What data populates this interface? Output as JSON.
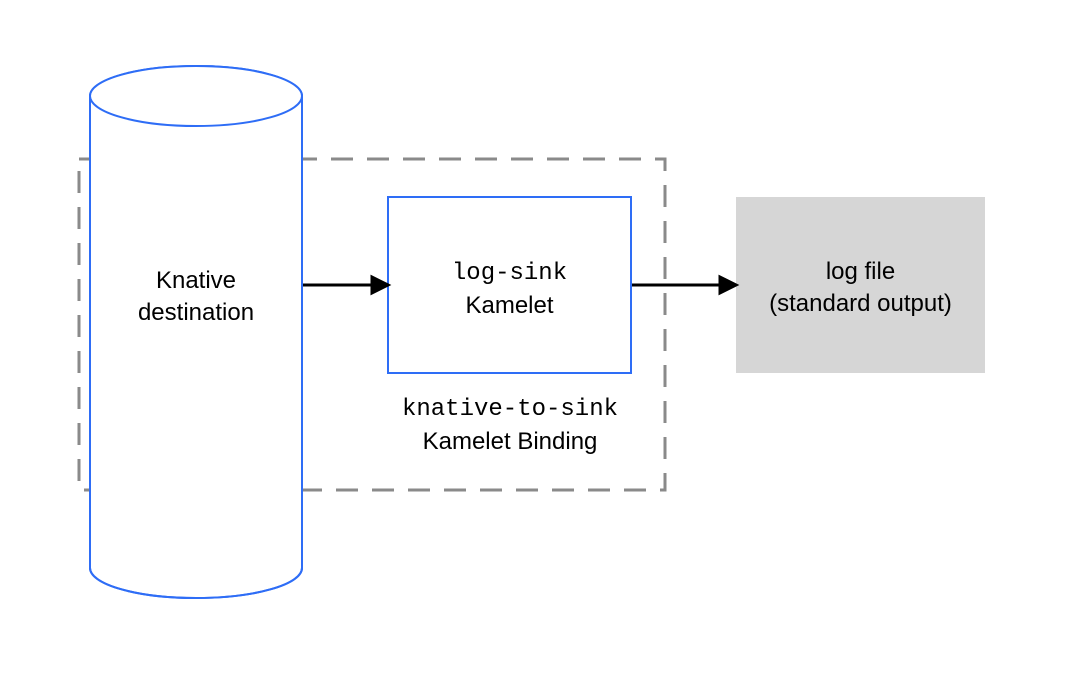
{
  "colors": {
    "blue": "#2e6df6",
    "gray_border": "#8a8a8a",
    "gray_fill": "#d6d6d6",
    "black": "#000000"
  },
  "shapes": {
    "cylinder": {
      "label_line1": "Knative",
      "label_line2": "destination"
    },
    "binding_box": {
      "caption_code": "knative-to-sink",
      "caption_text": "Kamelet Binding"
    },
    "kamelet_box": {
      "label_code": "log-sink",
      "label_text": "Kamelet"
    },
    "output_box": {
      "label_line1": "log file",
      "label_line2": "(standard output)"
    }
  }
}
